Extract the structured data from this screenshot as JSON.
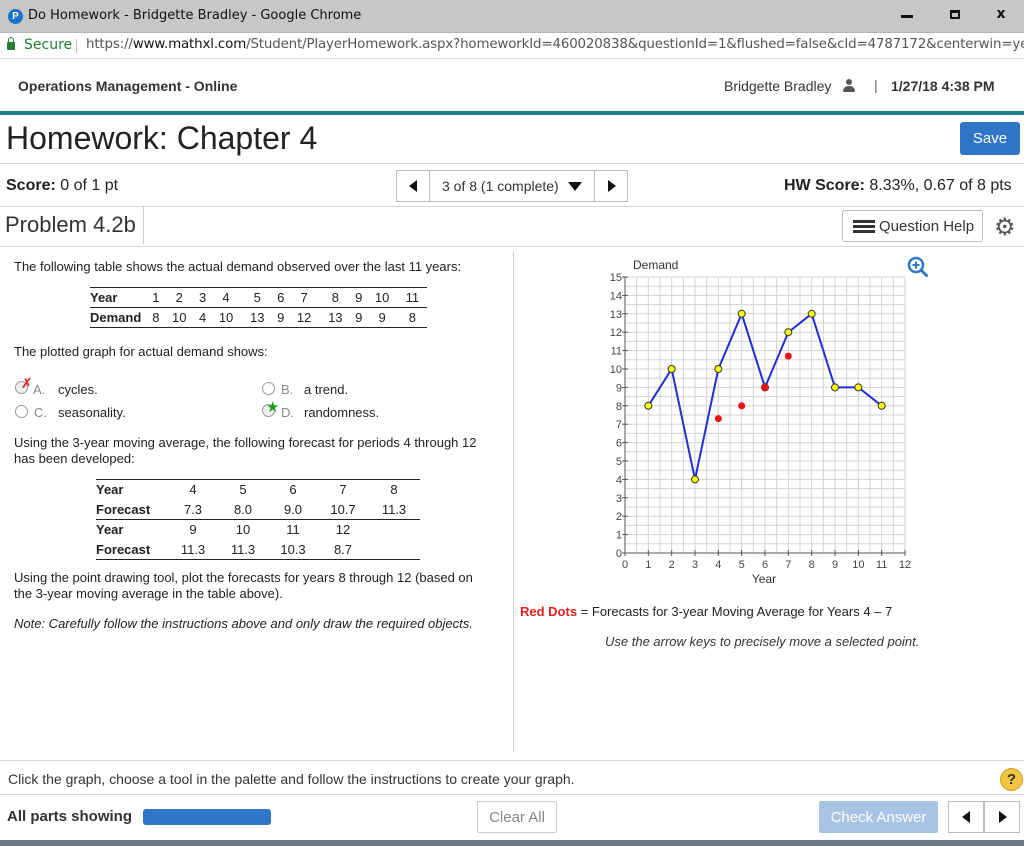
{
  "window": {
    "title": "Do Homework - Bridgette Bradley - Google Chrome",
    "logo_letter": "P",
    "close_glyph": "x"
  },
  "address_bar": {
    "secure_label": "Secure",
    "url_scheme": "https://",
    "url_host": "www.mathxl.com",
    "url_path": "/Student/PlayerHomework.aspx?homeworkId=460020838&questionId=1&flushed=false&cId=4787172&centerwin=yes"
  },
  "header": {
    "course": "Operations Management - Online",
    "user": "Bridgette Bradley",
    "separator": "|",
    "date": "1/27/18 4:38 PM"
  },
  "homework": {
    "title": "Homework: Chapter 4",
    "save_label": "Save",
    "score_label": "Score:",
    "score_value": "0 of 1 pt",
    "progress_text": "3 of 8 (1 complete)",
    "hw_score_label": "HW Score:",
    "hw_score_value": "8.33%, 0.67 of 8 pts",
    "problem_title": "Problem 4.2b",
    "help_label": "Question Help",
    "gear_glyph": "⚙"
  },
  "question": {
    "intro": "The following table shows the actual demand observed over the last 11 years:",
    "demand_table": {
      "row1_label": "Year",
      "years": [
        "1",
        "2",
        "3",
        "4",
        "5",
        "6",
        "7",
        "8",
        "9",
        "10",
        "11"
      ],
      "row2_label": "Demand",
      "demand": [
        "8",
        "10",
        "4",
        "10",
        "13",
        "9",
        "12",
        "13",
        "9",
        "9",
        "8"
      ]
    },
    "graph_shows": "The plotted graph for actual demand shows:",
    "options": [
      {
        "letter": "A.",
        "text": "cycles.",
        "mark": "✗"
      },
      {
        "letter": "B.",
        "text": "a trend.",
        "mark": ""
      },
      {
        "letter": "C.",
        "text": "seasonality.",
        "mark": ""
      },
      {
        "letter": "D.",
        "text": "randomness.",
        "mark": "★"
      }
    ],
    "moving_avg_line1": "Using the 3-year moving average, the following forecast for periods 4 through 12",
    "moving_avg_line2": "has been developed:",
    "forecast_table": {
      "year_label": "Year",
      "forecast_label": "Forecast",
      "row1_years": [
        "4",
        "5",
        "6",
        "7",
        "8"
      ],
      "row1_forecasts": [
        "7.3",
        "8.0",
        "9.0",
        "10.7",
        "11.3"
      ],
      "row2_years": [
        "9",
        "10",
        "11",
        "12"
      ],
      "row2_forecasts": [
        "11.3",
        "11.3",
        "10.3",
        "8.7"
      ]
    },
    "plot_instr_line1": "Using the point drawing tool, plot the forecasts for years 8 through 12 (based on",
    "plot_instr_line2": "the 3-year moving average in the table above).",
    "note": "Note: Carefully follow the instructions above and only draw the required objects."
  },
  "graph": {
    "legend_red": "Red Dots",
    "legend_rest": " = Forecasts for 3-year Moving Average for Years 4 – 7",
    "hint": "Use the arrow keys to precisely move a selected point."
  },
  "chart_data": {
    "type": "line",
    "ylabel": "Demand",
    "xlabel": "Year",
    "xlim": [
      0,
      12
    ],
    "ylim": [
      0,
      15
    ],
    "x_ticks": [
      0,
      1,
      2,
      3,
      4,
      5,
      6,
      7,
      8,
      9,
      10,
      11,
      12
    ],
    "y_ticks": [
      0,
      1,
      2,
      3,
      4,
      5,
      6,
      7,
      8,
      9,
      10,
      11,
      12,
      13,
      14,
      15
    ],
    "grid": true,
    "series": [
      {
        "x": [
          1,
          2,
          3,
          4,
          5,
          6,
          7,
          8,
          9,
          10,
          11
        ],
        "y": [
          8,
          10,
          4,
          10,
          13,
          9,
          12,
          13,
          9,
          9,
          8
        ],
        "color": "#1f2fd6",
        "marker_color": "#ffff00"
      },
      {
        "x": [
          4,
          5,
          6,
          7
        ],
        "y": [
          7.3,
          8.0,
          9.0,
          10.7
        ],
        "color": "#ee1111",
        "marker": "dot"
      }
    ]
  },
  "footer": {
    "instructions": "Click the graph, choose a tool in the palette and follow the instructions to create your graph.",
    "help_glyph": "?",
    "parts_label": "All parts showing",
    "clear_label": "Clear All",
    "check_label": "Check Answer"
  }
}
